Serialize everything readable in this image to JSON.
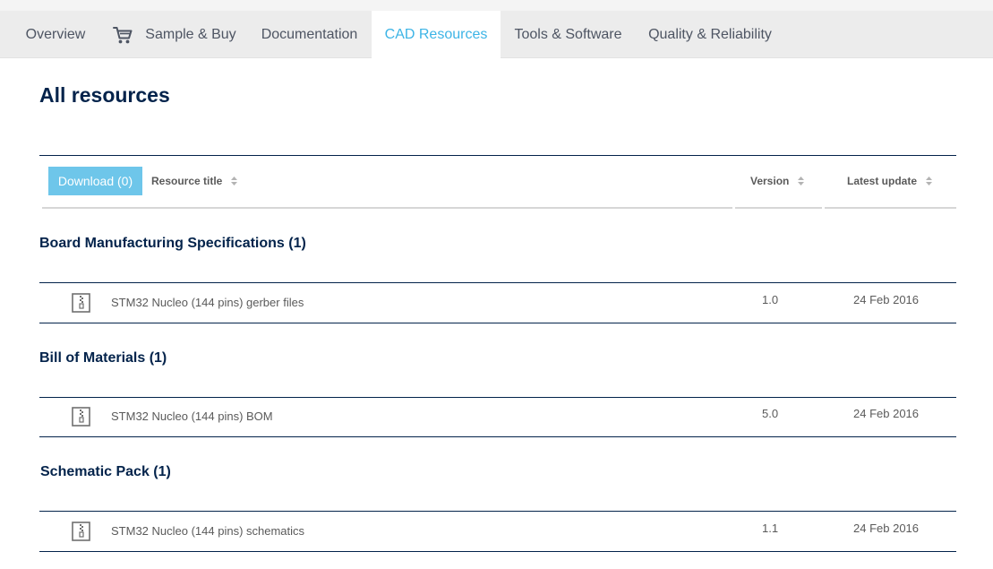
{
  "tabs": [
    {
      "label": "Overview"
    },
    {
      "label": "Sample & Buy",
      "icon": "cart-icon"
    },
    {
      "label": "Documentation"
    },
    {
      "label": "CAD Resources",
      "active": true
    },
    {
      "label": "Tools & Software"
    },
    {
      "label": "Quality & Reliability"
    }
  ],
  "page_title": "All resources",
  "table": {
    "download_label": "Download (0)",
    "columns": {
      "title": "Resource title",
      "version": "Version",
      "updated": "Latest update"
    }
  },
  "sections": [
    {
      "title": "Board Manufacturing Specifications (1)",
      "rows": [
        {
          "icon": "zip-file-icon",
          "title": "STM32 Nucleo (144 pins) gerber files",
          "version": "1.0",
          "updated": "24 Feb 2016"
        }
      ]
    },
    {
      "title": "Bill of Materials (1)",
      "rows": [
        {
          "icon": "zip-file-icon",
          "title": "STM32 Nucleo (144 pins) BOM",
          "version": "5.0",
          "updated": "24 Feb 2016"
        }
      ]
    },
    {
      "title": "Schematic Pack (1)",
      "rows": [
        {
          "icon": "zip-file-icon",
          "title": "STM32 Nucleo (144 pins) schematics",
          "version": "1.1",
          "updated": "24 Feb 2016"
        }
      ]
    }
  ],
  "colors": {
    "accent": "#3cb4e6",
    "download_button": "#6ec6ea",
    "heading": "#03234b",
    "text": "#5a5a5a",
    "tabbar": "#ececec"
  }
}
